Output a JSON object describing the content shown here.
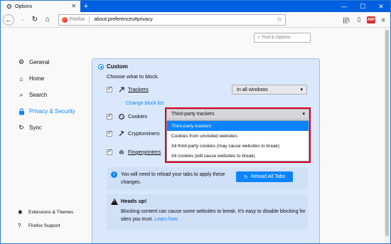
{
  "window": {
    "tab_title": "Options",
    "tab_close": "✕",
    "new_tab": "+",
    "controls": [
      "—",
      "☐",
      "✕"
    ]
  },
  "navbar": {
    "back": "←",
    "forward": "→",
    "reload": "↻",
    "home": "⌂",
    "identity": "Firefox",
    "url": "about:preferences#privacy",
    "star": "☆",
    "library": "|||\\",
    "sidebar": "▯",
    "abp": "ABP",
    "menu": "≡"
  },
  "search": {
    "placeholder": "Find in Options",
    "icon": "⌕"
  },
  "sidebar": {
    "items": [
      {
        "label": "General",
        "icon": "gear-icon",
        "glyph": "⚙"
      },
      {
        "label": "Home",
        "icon": "home-icon",
        "glyph": "⌂"
      },
      {
        "label": "Search",
        "icon": "search-icon",
        "glyph": "⌕"
      },
      {
        "label": "Privacy & Security",
        "icon": "lock-icon",
        "glyph": "🔒"
      },
      {
        "label": "Sync",
        "icon": "sync-icon",
        "glyph": "↻"
      }
    ],
    "footer": [
      {
        "label": "Extensions & Themes",
        "glyph": "✱"
      },
      {
        "label": "Firefox Support",
        "glyph": "?"
      }
    ]
  },
  "custom": {
    "title": "Custom",
    "subtitle": "Choose what to block.",
    "trackers": {
      "label": "Trackers",
      "scope": "In all windows"
    },
    "change_block_list": "Change block list",
    "cookies": {
      "label": "Cookies",
      "selected": "Third-party trackers"
    },
    "cryptominers": {
      "label": "Cryptominers"
    },
    "fingerprinters": {
      "label": "Fingerprinters"
    },
    "cookie_options": [
      "Third-party trackers",
      "Cookies from unvisited websites",
      "All third-party cookies (may cause websites to break)",
      "All cookies (will cause websites to break)"
    ]
  },
  "reload": {
    "text": "You will need to reload your tabs to apply these changes.",
    "button": "Reload All Tabs"
  },
  "heads_up": {
    "title": "Heads up!",
    "text": "Blocking content can cause some websites to break. It's easy to disable blocking for sites you trust.",
    "learn_how": "Learn how"
  }
}
